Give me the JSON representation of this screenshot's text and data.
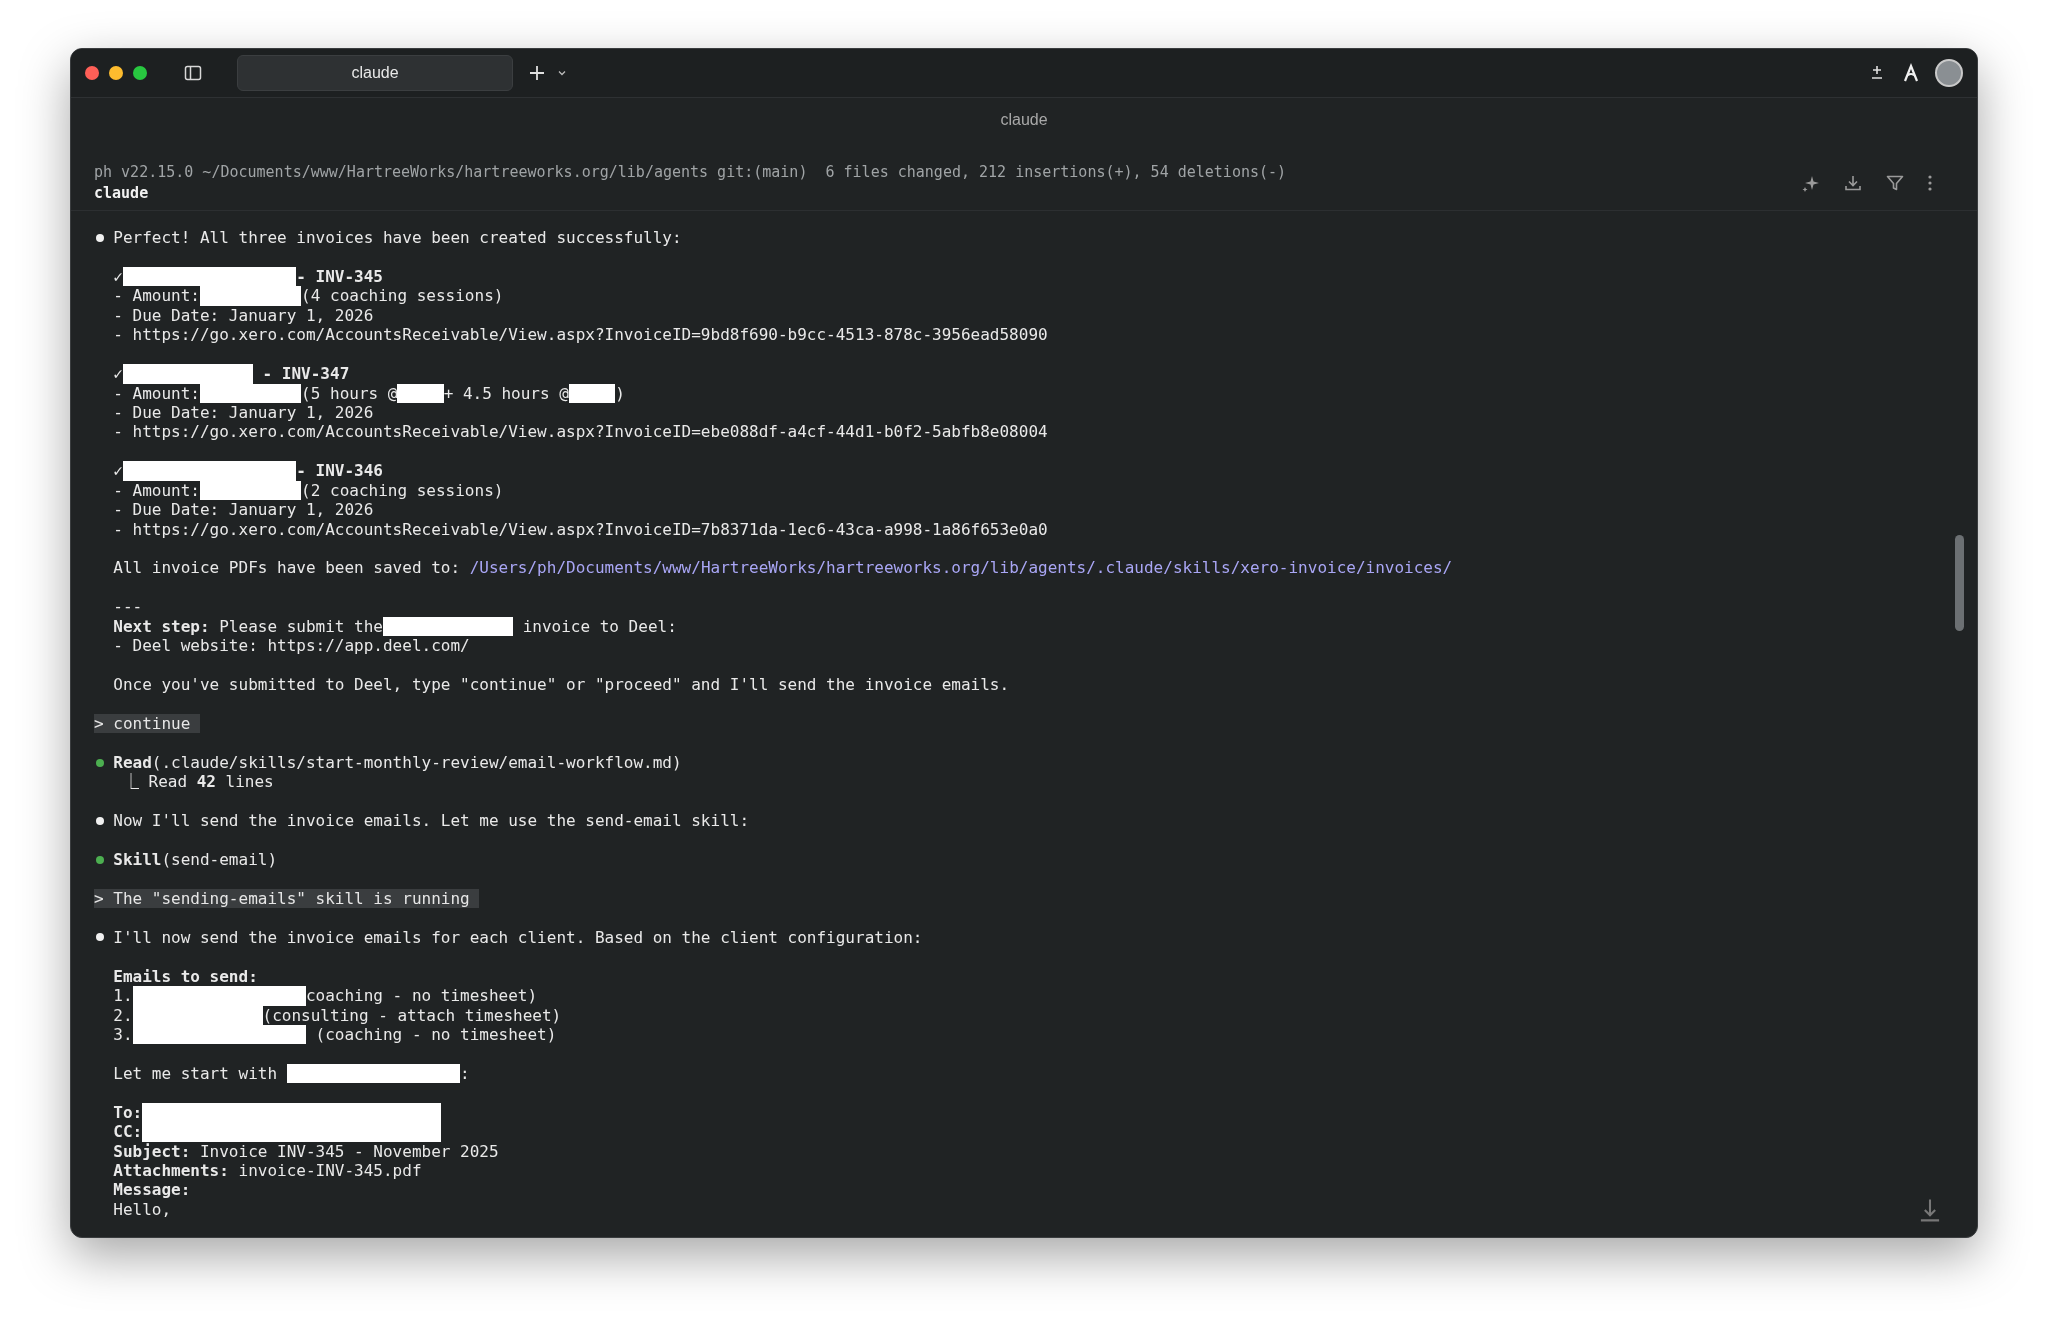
{
  "window": {
    "tab_title": "claude",
    "title": "claude"
  },
  "header": {
    "status_line": "ph v22.15.0 ~/Documents/www/HartreeWorks/hartreeworks.org/lib/agents git:(main)  6 files changed, 212 insertions(+), 54 deletions(-)",
    "command": "claude"
  },
  "lines": [
    {
      "kind": "bullet",
      "color": "#f0f0f0",
      "segments": [
        {
          "kind": "text",
          "text": "Perfect! All three invoices have been created successfully:"
        }
      ]
    },
    {
      "kind": "blank"
    },
    {
      "kind": "text",
      "segments": [
        {
          "kind": "bold",
          "text": "✓"
        },
        {
          "kind": "redacted-long"
        },
        {
          "kind": "bold",
          "text": "- INV-345"
        }
      ]
    },
    {
      "kind": "text",
      "segments": [
        {
          "kind": "text",
          "text": "- Amount:"
        },
        {
          "kind": "redacted-short"
        },
        {
          "kind": "text",
          "text": "(4 coaching sessions)"
        }
      ]
    },
    {
      "kind": "text",
      "segments": [
        {
          "kind": "text",
          "text": "- Due Date: January 1, 2026"
        }
      ]
    },
    {
      "kind": "text",
      "segments": [
        {
          "kind": "text",
          "text": "- https://go.xero.com/AccountsReceivable/View.aspx?InvoiceID=9bd8f690-b9cc-4513-878c-3956ead58090"
        }
      ]
    },
    {
      "kind": "blank"
    },
    {
      "kind": "text",
      "segments": [
        {
          "kind": "bold",
          "text": "✓"
        },
        {
          "kind": "redacted-medium"
        },
        {
          "kind": "bold",
          "text": " - INV-347"
        }
      ]
    },
    {
      "kind": "text",
      "segments": [
        {
          "kind": "text",
          "text": "- Amount:"
        },
        {
          "kind": "redacted-short"
        },
        {
          "kind": "text",
          "text": "(5 hours @"
        },
        {
          "kind": "redacted-tiny"
        },
        {
          "kind": "text",
          "text": "+ 4.5 hours @"
        },
        {
          "kind": "redacted-tiny"
        },
        {
          "kind": "text",
          "text": ")"
        }
      ]
    },
    {
      "kind": "text",
      "segments": [
        {
          "kind": "text",
          "text": "- Due Date: January 1, 2026"
        }
      ]
    },
    {
      "kind": "text",
      "segments": [
        {
          "kind": "text",
          "text": "- https://go.xero.com/AccountsReceivable/View.aspx?InvoiceID=ebe088df-a4cf-44d1-b0f2-5abfb8e08004"
        }
      ]
    },
    {
      "kind": "blank"
    },
    {
      "kind": "text",
      "segments": [
        {
          "kind": "bold",
          "text": "✓"
        },
        {
          "kind": "redacted-long"
        },
        {
          "kind": "bold",
          "text": "- INV-346"
        }
      ]
    },
    {
      "kind": "text",
      "segments": [
        {
          "kind": "text",
          "text": "- Amount:"
        },
        {
          "kind": "redacted-short"
        },
        {
          "kind": "text",
          "text": "(2 coaching sessions)"
        }
      ]
    },
    {
      "kind": "text",
      "segments": [
        {
          "kind": "text",
          "text": "- Due Date: January 1, 2026"
        }
      ]
    },
    {
      "kind": "text",
      "segments": [
        {
          "kind": "text",
          "text": "- https://go.xero.com/AccountsReceivable/View.aspx?InvoiceID=7b8371da-1ec6-43ca-a998-1a86f653e0a0"
        }
      ]
    },
    {
      "kind": "blank"
    },
    {
      "kind": "text",
      "segments": [
        {
          "kind": "text",
          "text": "All invoice PDFs have been saved to: "
        },
        {
          "kind": "link",
          "text": "/Users/ph/Documents/www/HartreeWorks/hartreeworks.org/lib/agents/.claude/skills/xero-invoice/invoices/"
        }
      ]
    },
    {
      "kind": "blank"
    },
    {
      "kind": "text",
      "segments": [
        {
          "kind": "text",
          "text": "---"
        }
      ]
    },
    {
      "kind": "text",
      "segments": [
        {
          "kind": "text",
          "text": "**Next step:** Please submit the"
        },
        {
          "kind": "redacted-medium"
        },
        {
          "kind": "text",
          "text": " invoice to Deel:"
        }
      ]
    },
    {
      "kind": "text",
      "segments": [
        {
          "kind": "text",
          "text": "- Deel website: https://app.deel.com/"
        }
      ]
    },
    {
      "kind": "blank"
    },
    {
      "kind": "text",
      "segments": [
        {
          "kind": "text",
          "text": "Once you've submitted to Deel, type \"continue\" or \"proceed\" and I'll send the invoice emails."
        }
      ]
    },
    {
      "kind": "blank"
    },
    {
      "kind": "prompt",
      "text": "> continue"
    },
    {
      "kind": "blank"
    },
    {
      "kind": "bullet",
      "color": "#4caf50",
      "segments": [
        {
          "kind": "text",
          "text": "**Read**(.claude/skills/start-monthly-review/email-workflow.md)"
        }
      ]
    },
    {
      "kind": "result",
      "segments": [
        {
          "kind": "text",
          "text": "⎿ Read **42** lines"
        }
      ]
    },
    {
      "kind": "blank"
    },
    {
      "kind": "bullet",
      "color": "#f0f0f0",
      "segments": [
        {
          "kind": "text",
          "text": "Now I'll send the invoice emails. Let me use the send-email skill:"
        }
      ]
    },
    {
      "kind": "blank"
    },
    {
      "kind": "bullet",
      "color": "#4caf50",
      "segments": [
        {
          "kind": "text",
          "text": "**Skill**(send-email)"
        }
      ]
    },
    {
      "kind": "blank"
    },
    {
      "kind": "prompt",
      "text": "> The \"sending-emails\" skill is running"
    },
    {
      "kind": "blank"
    },
    {
      "kind": "bullet",
      "color": "#f0f0f0",
      "segments": [
        {
          "kind": "text",
          "text": "I'll now send the invoice emails for each client. Based on the client configuration:"
        }
      ]
    },
    {
      "kind": "blank"
    },
    {
      "kind": "text",
      "segments": [
        {
          "kind": "bold",
          "text": "Emails to send:"
        }
      ]
    },
    {
      "kind": "text",
      "segments": [
        {
          "kind": "text",
          "text": "1."
        },
        {
          "kind": "redacted-long"
        },
        {
          "kind": "text",
          "text": "coaching - no timesheet)"
        }
      ]
    },
    {
      "kind": "text",
      "segments": [
        {
          "kind": "text",
          "text": "2."
        },
        {
          "kind": "redacted-medium"
        },
        {
          "kind": "text",
          "text": "(consulting - attach timesheet)"
        }
      ]
    },
    {
      "kind": "text",
      "segments": [
        {
          "kind": "text",
          "text": "3."
        },
        {
          "kind": "redacted-long"
        },
        {
          "kind": "text",
          "text": " (coaching - no timesheet)"
        }
      ]
    },
    {
      "kind": "blank"
    },
    {
      "kind": "text",
      "segments": [
        {
          "kind": "text",
          "text": "Let me start with "
        },
        {
          "kind": "redacted-long"
        },
        {
          "kind": "text",
          "text": ":"
        }
      ]
    },
    {
      "kind": "blank"
    },
    {
      "kind": "text",
      "segments": [
        {
          "kind": "bold",
          "text": "To:"
        },
        {
          "kind": "redacted-wide"
        }
      ]
    },
    {
      "kind": "text",
      "segments": [
        {
          "kind": "bold",
          "text": "CC:"
        },
        {
          "kind": "redacted-wide"
        }
      ]
    },
    {
      "kind": "text",
      "segments": [
        {
          "kind": "text",
          "text": "**Subject:** Invoice INV-345 - November 2025"
        }
      ]
    },
    {
      "kind": "text",
      "segments": [
        {
          "kind": "text",
          "text": "**Attachments:** invoice-INV-345.pdf"
        }
      ]
    },
    {
      "kind": "text",
      "segments": [
        {
          "kind": "bold",
          "text": "Message:"
        }
      ]
    },
    {
      "kind": "text",
      "segments": [
        {
          "kind": "text",
          "text": "Hello,"
        }
      ]
    }
  ]
}
